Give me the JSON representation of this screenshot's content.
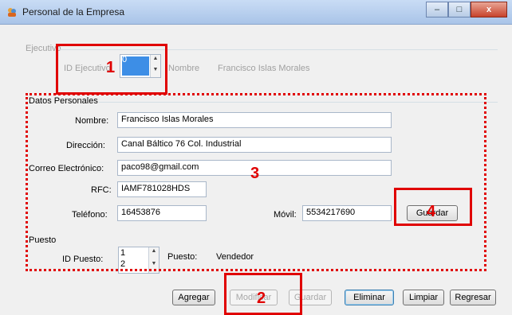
{
  "window": {
    "title": "Personal de la Empresa",
    "minimize": "–",
    "maximize": "□",
    "close": "x"
  },
  "ejecutivo": {
    "group_label": "Ejecutivo",
    "id_label": "ID Ejecutivo",
    "id_value": "0",
    "nombre_label": "Nombre",
    "nombre_value": "Francisco Islas Morales"
  },
  "datos": {
    "group_label": "Datos Personales",
    "nombre_label": "Nombre:",
    "nombre_value": "Francisco Islas Morales",
    "direccion_label": "Dirección:",
    "direccion_value": "Canal Báltico 76 Col. Industrial",
    "correo_label": "Correo Electrónico:",
    "correo_value": "paco98@gmail.com",
    "rfc_label": "RFC:",
    "rfc_value": "IAMF781028HDS",
    "telefono_label": "Teléfono:",
    "telefono_value": "16453876",
    "movil_label": "Móvil:",
    "movil_value": "5534217690",
    "guardar_label": "Guardar"
  },
  "puesto": {
    "group_label": "Puesto",
    "id_label": "ID Puesto:",
    "id_values": [
      "1",
      "2"
    ],
    "puesto_label": "Puesto:",
    "puesto_value": "Vendedor"
  },
  "buttons": {
    "agregar": "Agregar",
    "modificar": "Modificar",
    "guardar": "Guardar",
    "eliminar": "Eliminar",
    "limpiar": "Limpiar",
    "regresar": "Regresar"
  },
  "annotations": {
    "n1": "1",
    "n2": "2",
    "n3": "3",
    "n4": "4"
  },
  "colors": {
    "annotation": "#e00000",
    "titlebar": "#b9d1f0"
  }
}
